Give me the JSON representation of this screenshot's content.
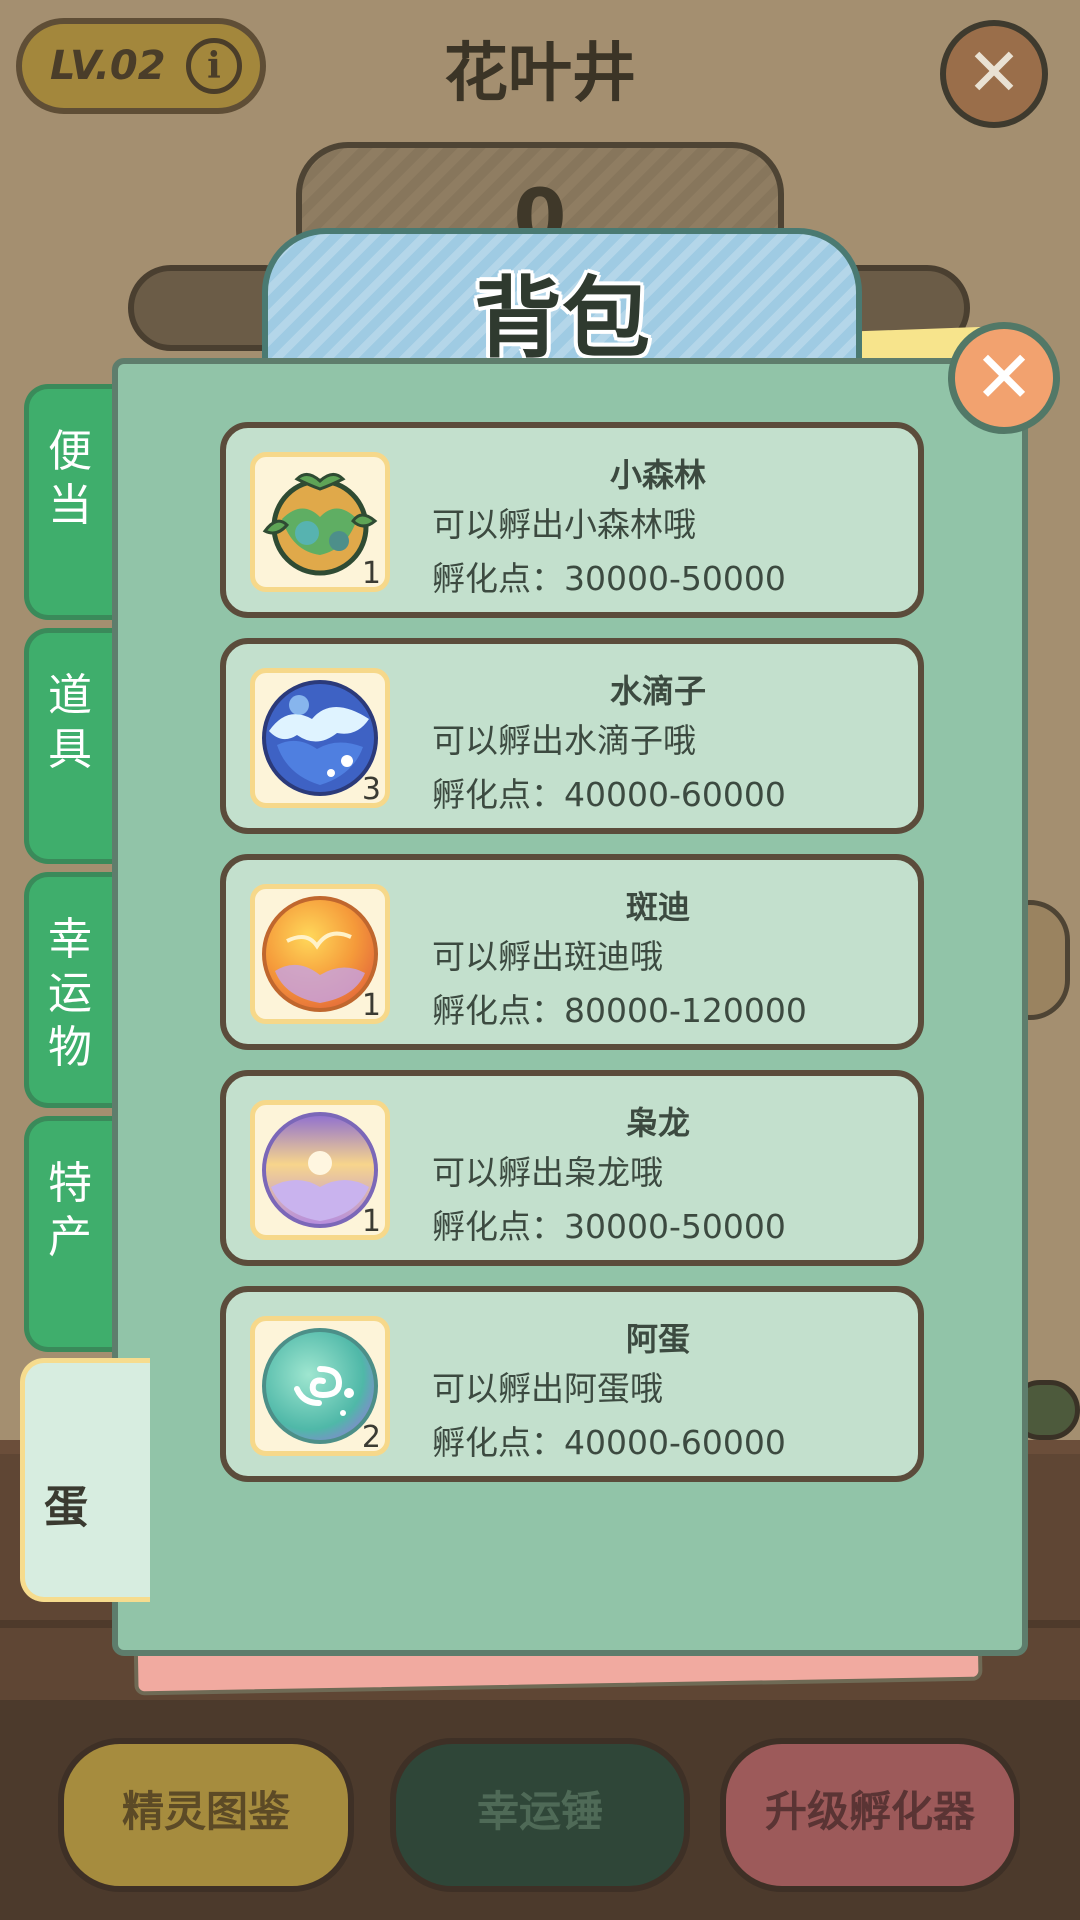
{
  "header": {
    "level_label": "LV.02",
    "info_glyph": "i",
    "title": "花叶井",
    "close_glyph": "✕"
  },
  "counter": {
    "value": "0"
  },
  "modal": {
    "title": "背包",
    "close_glyph": "✕",
    "tabs": [
      {
        "label": "便当",
        "active": false
      },
      {
        "label": "道具",
        "active": false
      },
      {
        "label": "幸运物",
        "active": false
      },
      {
        "label": "特产",
        "active": false
      },
      {
        "label": "蛋",
        "active": true
      }
    ],
    "items": [
      {
        "name": "小森林",
        "desc": "可以孵出小森林哦",
        "points": "孵化点：30000-50000",
        "count": "1",
        "icon": "forest-egg-icon"
      },
      {
        "name": "水滴子",
        "desc": "可以孵出水滴子哦",
        "points": "孵化点：40000-60000",
        "count": "3",
        "icon": "water-egg-icon"
      },
      {
        "name": "斑迪",
        "desc": "可以孵出斑迪哦",
        "points": "孵化点：80000-120000",
        "count": "1",
        "icon": "fire-egg-icon"
      },
      {
        "name": "枭龙",
        "desc": "可以孵出枭龙哦",
        "points": "孵化点：30000-50000",
        "count": "1",
        "icon": "dawn-egg-icon"
      },
      {
        "name": "阿蛋",
        "desc": "可以孵出阿蛋哦",
        "points": "孵化点：40000-60000",
        "count": "2",
        "icon": "swirl-egg-icon"
      }
    ]
  },
  "footer": {
    "gallery": "精灵图鉴",
    "hammer": "幸运锤",
    "upgrade": "升级孵化器"
  },
  "colors": {
    "tab_green": "#3fae6c",
    "panel": "#91c4a8",
    "card": "#c3e0cd",
    "header_blue": "#9fcbe3",
    "close_orange": "#f2a26f"
  }
}
